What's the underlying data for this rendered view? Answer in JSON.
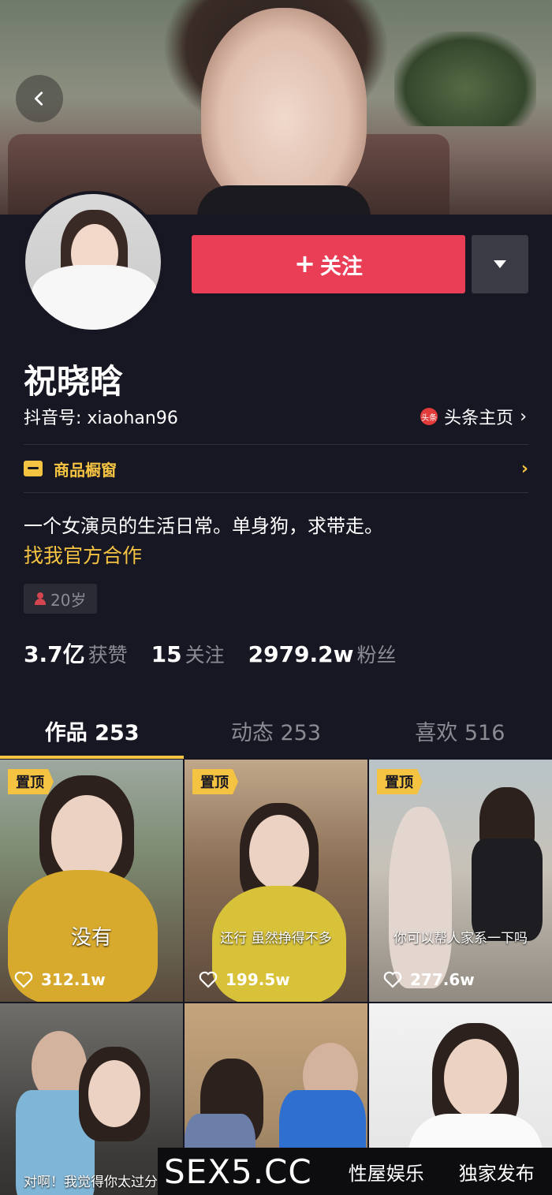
{
  "header": {
    "back_icon": "chevron-left-icon"
  },
  "profile": {
    "follow_label": "关注",
    "follow_plus": "+",
    "name": "祝晓晗",
    "douyin_id": "抖音号: xiaohan96",
    "toutiao_badge": "头条",
    "toutiao_label": "头条主页",
    "toutiao_chevron": "›",
    "shop_label": "商品橱窗",
    "shop_chevron": "›",
    "bio": "一个女演员的生活日常。单身狗，求带走。",
    "collab_link": "找我官方合作",
    "age_tag": "20岁"
  },
  "stats": [
    {
      "value": "3.7亿",
      "label": "获赞"
    },
    {
      "value": "15",
      "label": "关注"
    },
    {
      "value": "2979.2w",
      "label": "粉丝"
    }
  ],
  "tabs": [
    {
      "label": "作品 253",
      "active": true
    },
    {
      "label": "动态 253",
      "active": false
    },
    {
      "label": "喜欢 516",
      "active": false
    }
  ],
  "videos": [
    {
      "pinned": "置顶",
      "likes": "312.1w",
      "caption": "没有"
    },
    {
      "pinned": "置顶",
      "likes": "199.5w",
      "caption": "还行 虽然挣得不多"
    },
    {
      "pinned": "置顶",
      "likes": "277.6w",
      "caption": "你可以帮人家系一下吗"
    },
    {
      "caption": "对啊！我觉得你太过分了"
    }
  ],
  "watermark": {
    "logo": "SEX5.CC",
    "link1": "性屋娱乐",
    "link2": "独家发布"
  },
  "colors": {
    "background": "#161722",
    "follow_red": "#ea3e57",
    "accent_yellow": "#f5c342",
    "muted_text": "#8a8b93"
  }
}
